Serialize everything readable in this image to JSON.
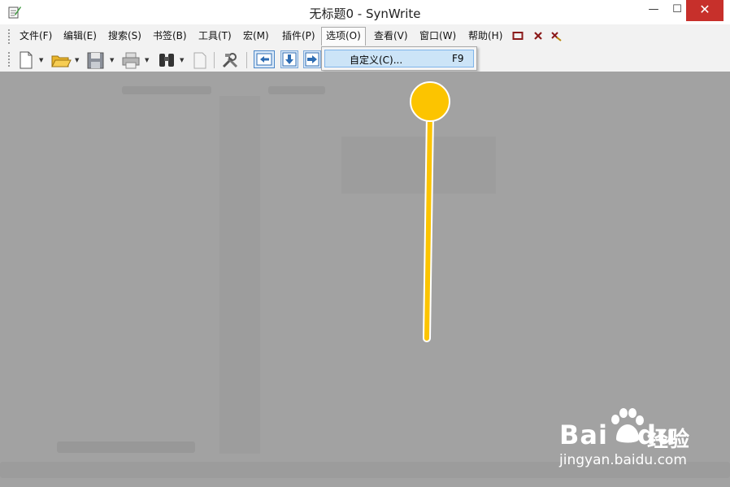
{
  "window": {
    "title": "无标题0 - SynWrite",
    "minimize_glyph": "—",
    "maximize_glyph": "☐",
    "close_glyph": "✕"
  },
  "menu": {
    "items": [
      {
        "label": "文件(F)"
      },
      {
        "label": "编辑(E)"
      },
      {
        "label": "搜索(S)"
      },
      {
        "label": "书签(B)"
      },
      {
        "label": "工具(T)"
      },
      {
        "label": "宏(M)"
      },
      {
        "label": "插件(P)"
      },
      {
        "label": "选项(O)",
        "active": true
      },
      {
        "label": "查看(V)"
      },
      {
        "label": "窗口(W)"
      },
      {
        "label": "帮助(H)"
      }
    ],
    "mdi_icons": [
      "restore-icon",
      "close-document-icon",
      "unpin-icon"
    ]
  },
  "toolbar": {
    "buttons": [
      "new-file-icon",
      "open-folder-icon",
      "save-icon",
      "print-icon",
      "find-binoculars-icon",
      "page-icon",
      "tools-icon",
      "nav-left-icon",
      "nav-down-icon",
      "nav-right-icon"
    ]
  },
  "dropdown": {
    "items": [
      {
        "label": "自定义(C)...",
        "shortcut": "F9"
      }
    ]
  },
  "watermark": {
    "brand": "Bai",
    "brand_suffix": "du",
    "brand_cn": "经验",
    "url": "jingyan.baidu.com"
  },
  "colors": {
    "accent_pointer": "#fcc400",
    "highlight": "#cce4f7",
    "close_button": "#c7302b",
    "dim_overlay": "#a2a2a2"
  }
}
